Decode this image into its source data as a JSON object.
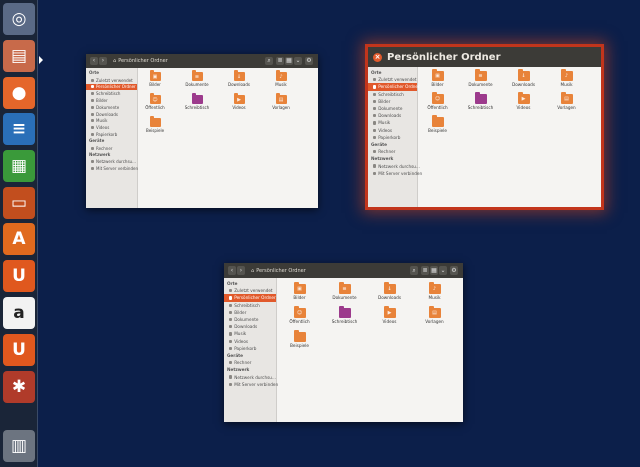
{
  "launcher": {
    "items": [
      {
        "name": "dash-button",
        "icon": "ubuntu-logo-icon",
        "glyph": "◎",
        "bg": "#5a6a86"
      },
      {
        "name": "files-launcher",
        "icon": "file-cabinet-icon",
        "glyph": "▤",
        "bg": "#c86a4a"
      },
      {
        "name": "firefox-launcher",
        "icon": "firefox-icon",
        "glyph": "●",
        "bg": "#e5662a"
      },
      {
        "name": "writer-launcher",
        "icon": "libreoffice-writer-icon",
        "glyph": "≡",
        "bg": "#2a6fb8"
      },
      {
        "name": "calc-launcher",
        "icon": "libreoffice-calc-icon",
        "glyph": "▦",
        "bg": "#3a9a3a"
      },
      {
        "name": "impress-launcher",
        "icon": "libreoffice-impress-icon",
        "glyph": "▭",
        "bg": "#c24e1e"
      },
      {
        "name": "software-center-launcher",
        "icon": "shopping-bag-icon",
        "glyph": "A",
        "bg": "#e06a1e"
      },
      {
        "name": "ubuntu-one-launcher",
        "icon": "ubuntu-one-icon",
        "glyph": "U",
        "bg": "#e0581e"
      },
      {
        "name": "amazon-launcher",
        "icon": "amazon-icon",
        "glyph": "a",
        "bg": "#f2f2f2"
      },
      {
        "name": "ubuntu-one-music-launcher",
        "icon": "ubuntu-one-music-icon",
        "glyph": "U",
        "bg": "#e0581e"
      },
      {
        "name": "system-settings-launcher",
        "icon": "settings-wrench-icon",
        "glyph": "✱",
        "bg": "#b03b2a"
      },
      {
        "name": "trash-launcher",
        "icon": "trash-icon",
        "glyph": "▥",
        "bg": "#6c7480"
      }
    ]
  },
  "sidebar": {
    "heading_places": "Orte",
    "places": [
      {
        "label": "Zuletzt verwendet",
        "icon": "clock-icon"
      },
      {
        "label": "Persönlicher Ordner",
        "icon": "home-icon",
        "selected": true
      },
      {
        "label": "Schreibtisch",
        "icon": "desktop-icon"
      },
      {
        "label": "Bilder",
        "icon": "pictures-icon"
      },
      {
        "label": "Dokumente",
        "icon": "documents-icon"
      },
      {
        "label": "Downloads",
        "icon": "downloads-icon"
      },
      {
        "label": "Musik",
        "icon": "music-icon"
      },
      {
        "label": "Videos",
        "icon": "videos-icon"
      },
      {
        "label": "Papierkorb",
        "icon": "trash-icon"
      }
    ],
    "heading_devices": "Geräte",
    "devices": [
      {
        "label": "Rechner",
        "icon": "computer-icon"
      }
    ],
    "heading_network": "Netzwerk",
    "network": [
      {
        "label": "Netzwerk durchsu...",
        "icon": "network-icon"
      },
      {
        "label": "Mit Server verbinden",
        "icon": "server-icon"
      }
    ]
  },
  "folders": [
    {
      "label": "Bilder",
      "icon": "pictures-folder-icon",
      "color": "#e8833a",
      "emblem": "▣"
    },
    {
      "label": "Dokumente",
      "icon": "documents-folder-icon",
      "color": "#e8833a",
      "emblem": "≡"
    },
    {
      "label": "Downloads",
      "icon": "downloads-folder-icon",
      "color": "#e8833a",
      "emblem": "↓"
    },
    {
      "label": "Musik",
      "icon": "music-folder-icon",
      "color": "#e8833a",
      "emblem": "♪"
    },
    {
      "label": "Öffentlich",
      "icon": "public-folder-icon",
      "color": "#e8833a",
      "emblem": "☺"
    },
    {
      "label": "Schreibtisch",
      "icon": "desktop-folder-icon",
      "color": "#9c3a8c",
      "emblem": ""
    },
    {
      "label": "Videos",
      "icon": "videos-folder-icon",
      "color": "#e8833a",
      "emblem": "▶"
    },
    {
      "label": "Vorlagen",
      "icon": "templates-folder-icon",
      "color": "#e8833a",
      "emblem": "▤"
    },
    {
      "label": "Beispiele",
      "icon": "examples-folder-icon",
      "color": "#e8833a",
      "emblem": ""
    }
  ],
  "win1": {
    "title": "Persönlicher Ordner"
  },
  "win2": {
    "title": "Persönlicher Ordner",
    "close_glyph": "×"
  },
  "win3": {
    "title": "Persönlicher Ordner"
  },
  "toolbar": {
    "back_glyph": "‹",
    "forward_glyph": "›",
    "home_glyph": "⌂",
    "search_glyph": "⌕",
    "list_glyph": "≣",
    "grid_glyph": "▦",
    "menu_glyph": "⌄",
    "gear_glyph": "⚙"
  }
}
